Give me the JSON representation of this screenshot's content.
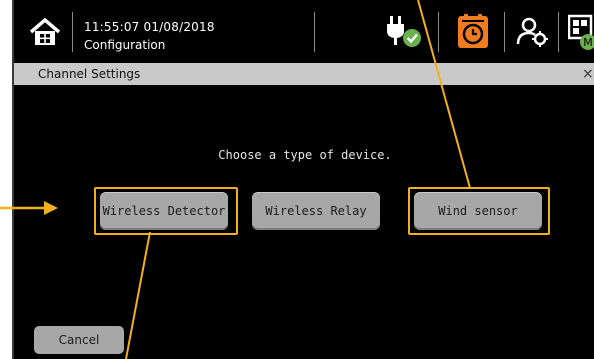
{
  "statusbar": {
    "time": "11:55:07  01/08/2018",
    "subtitle": "Configuration",
    "icons": [
      "home-icon",
      "power-plug-check-icon",
      "alarm-clock-icon",
      "user-settings-icon",
      "mode-grid-icon"
    ],
    "mode_badge": "M"
  },
  "dialog": {
    "title": "Channel Settings",
    "close": "×",
    "prompt": "Choose a type of device.",
    "options": [
      "Wireless Detector",
      "Wireless Relay",
      "Wind sensor"
    ],
    "cancel_label": "Cancel"
  },
  "colors": {
    "highlight": "#f2b01e",
    "accent_orange": "#f07c1f",
    "check_green": "#6ab04c",
    "button_gray": "#a7a7a7",
    "titlebar_gray": "#c9c9c9"
  }
}
